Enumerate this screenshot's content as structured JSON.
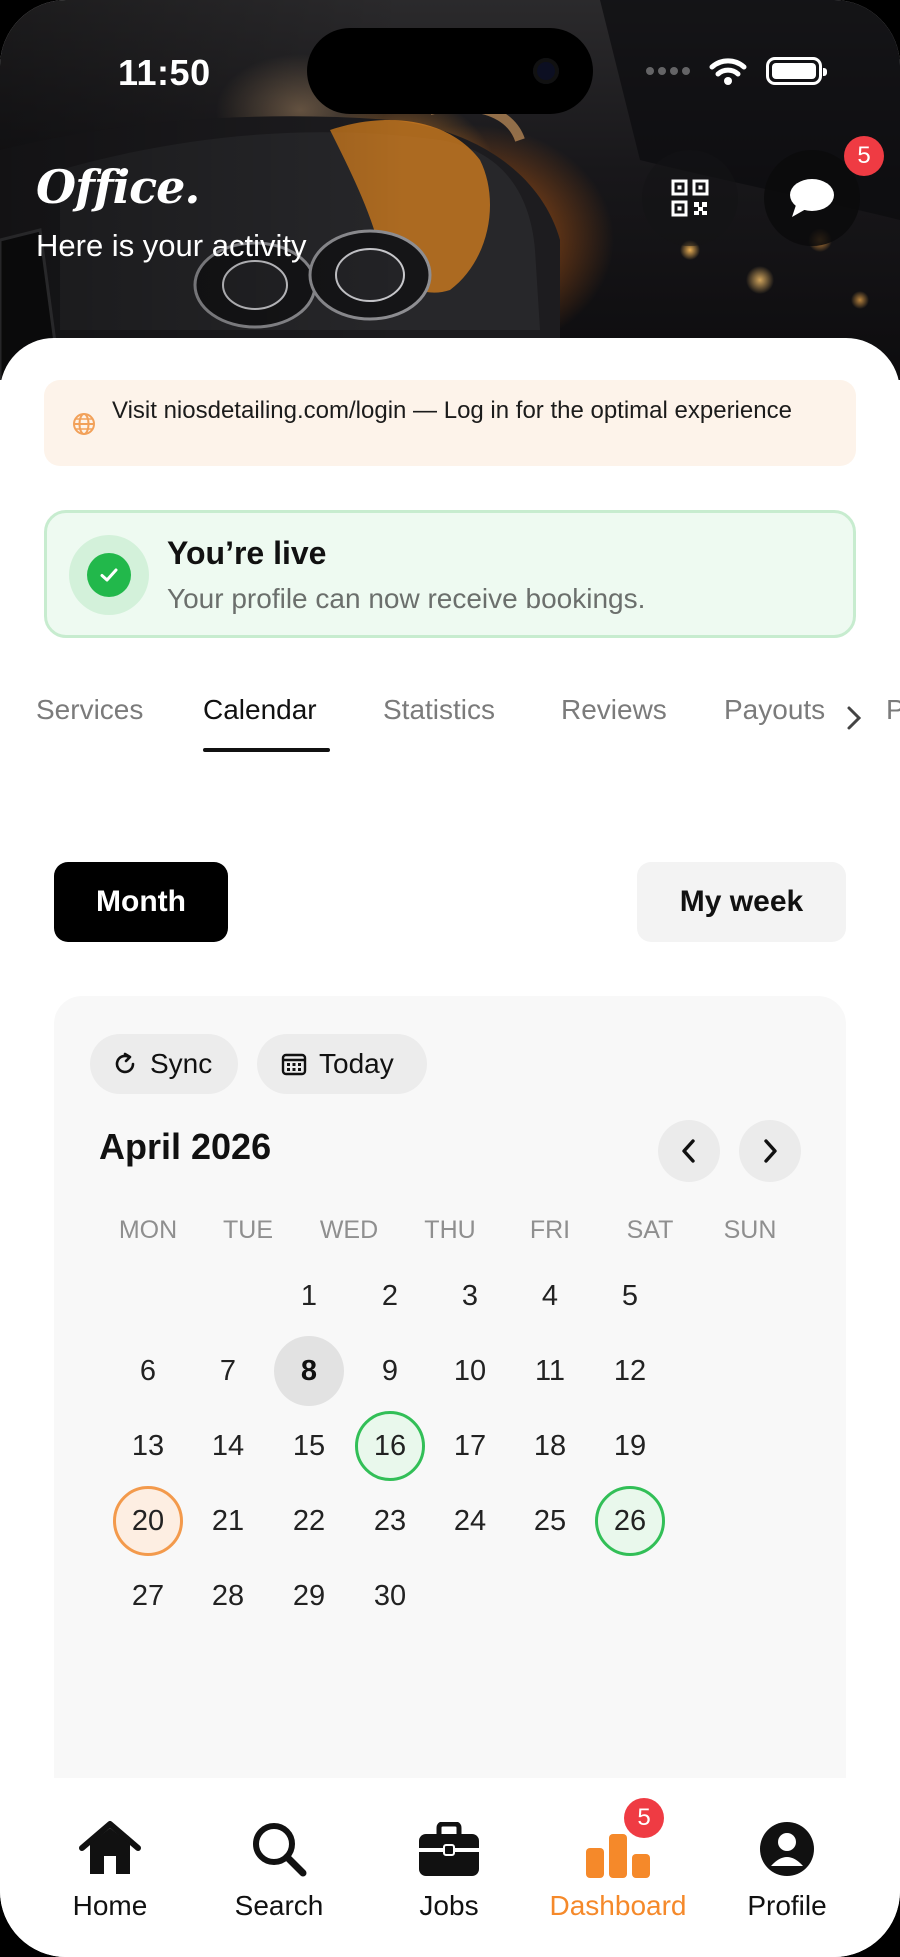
{
  "status_bar": {
    "time": "11:50"
  },
  "header": {
    "brand": "Office.",
    "subtitle": "Here is your activity",
    "messages_badge": "5",
    "qr_icon": "qr-code-icon",
    "chat_icon": "chat-bubble-icon"
  },
  "notice": {
    "text": "Visit niosdetailing.com/login — Log in for the optimal experience",
    "icon": "globe-icon"
  },
  "live_card": {
    "title": "You’re live",
    "subtitle": "Your profile can now receive bookings."
  },
  "tabs": [
    {
      "label": "Services",
      "active": false
    },
    {
      "label": "Calendar",
      "active": true
    },
    {
      "label": "Statistics",
      "active": false
    },
    {
      "label": "Reviews",
      "active": false
    },
    {
      "label": "Payouts",
      "active": false
    },
    {
      "label": "P",
      "active": false
    }
  ],
  "view_toggle": {
    "month": "Month",
    "week": "My week",
    "selected": "Month"
  },
  "calendar": {
    "sync_label": "Sync",
    "today_label": "Today",
    "month_title": "April 2026",
    "weekdays": [
      "MON",
      "TUE",
      "WED",
      "THU",
      "FRI",
      "SAT",
      "SUN"
    ],
    "first_weekday_index": 2,
    "days_in_month": 30,
    "today": 8,
    "green_days": [
      16,
      26
    ],
    "orange_days": [
      20
    ]
  },
  "bottom_nav": [
    {
      "label": "Home",
      "icon": "home-icon",
      "active": false
    },
    {
      "label": "Search",
      "icon": "search-icon",
      "active": false
    },
    {
      "label": "Jobs",
      "icon": "briefcase-icon",
      "active": false
    },
    {
      "label": "Dashboard",
      "icon": "bar-chart-icon",
      "active": true,
      "badge": "5"
    },
    {
      "label": "Profile",
      "icon": "user-circle-icon",
      "active": false
    }
  ],
  "colors": {
    "accent": "#f5892a",
    "live_green": "#22b84b",
    "badge_red": "#ef3b43"
  }
}
